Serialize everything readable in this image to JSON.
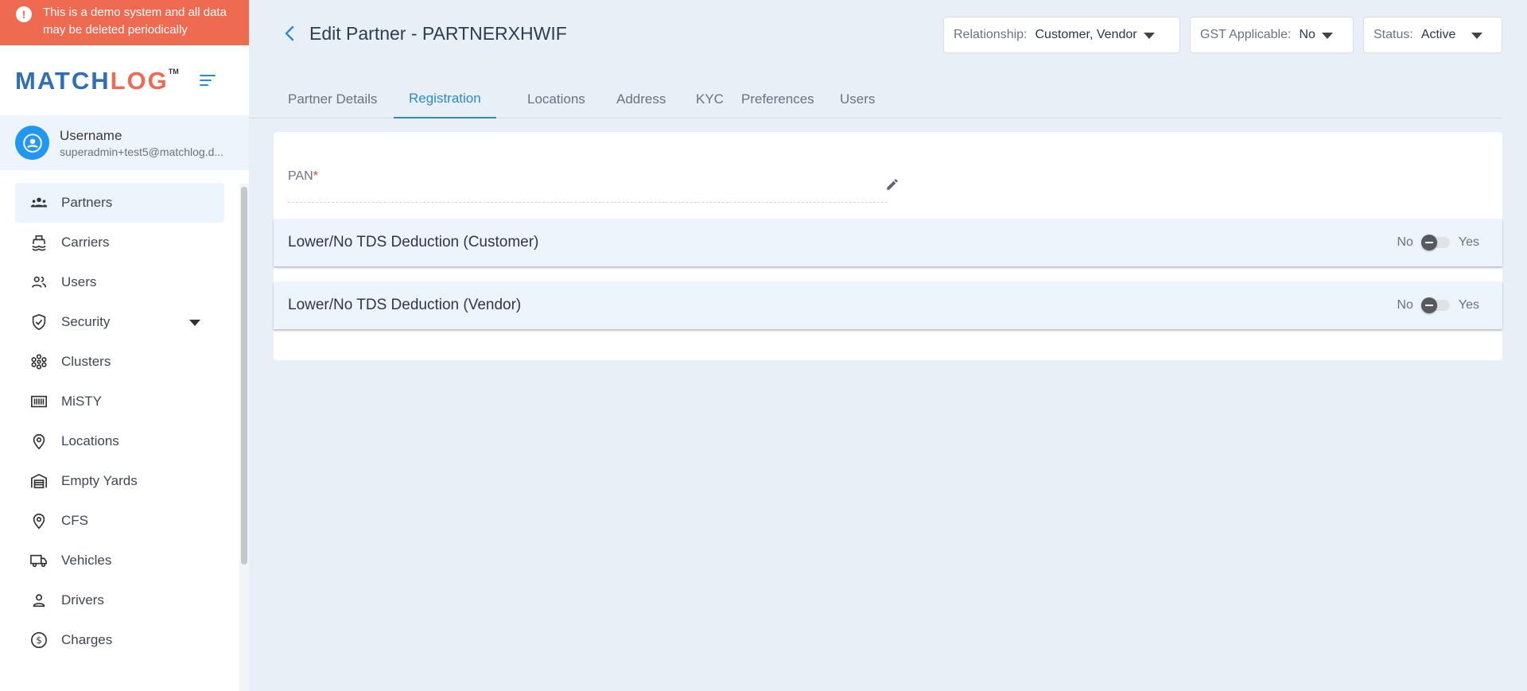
{
  "banner": {
    "text": "This is a demo system and all data may be deleted periodically"
  },
  "logo": {
    "part1": "MATCH",
    "part2": "LOG",
    "tm": "TM"
  },
  "user": {
    "name": "Username",
    "email": "superadmin+test5@matchlog.d..."
  },
  "nav": {
    "items": [
      {
        "label": "Partners",
        "icon": "partners-icon"
      },
      {
        "label": "Carriers",
        "icon": "ship-icon"
      },
      {
        "label": "Users",
        "icon": "users-icon"
      },
      {
        "label": "Security",
        "icon": "shield-icon"
      },
      {
        "label": "Clusters",
        "icon": "clusters-icon"
      },
      {
        "label": "MiSTY",
        "icon": "container-icon"
      },
      {
        "label": "Locations",
        "icon": "location-pin-icon"
      },
      {
        "label": "Empty Yards",
        "icon": "warehouse-icon"
      },
      {
        "label": "CFS",
        "icon": "location-pin-icon"
      },
      {
        "label": "Vehicles",
        "icon": "truck-icon"
      },
      {
        "label": "Drivers",
        "icon": "person-icon"
      },
      {
        "label": "Charges",
        "icon": "dollar-icon"
      }
    ]
  },
  "header": {
    "title": "Edit Partner - PARTNERXHWIF",
    "relationship": {
      "label": "Relationship:",
      "value": "Customer, Vendor"
    },
    "gst": {
      "label": "GST Applicable:",
      "value": "No"
    },
    "status": {
      "label": "Status:",
      "value": "Active"
    }
  },
  "tabs": [
    "Partner Details",
    "Registration",
    "Locations",
    "Address",
    "KYC",
    "Preferences",
    "Users"
  ],
  "form": {
    "pan_label": "PAN",
    "pan_required": "*",
    "panels": [
      {
        "title": "Lower/No TDS Deduction (Customer)",
        "no": "No",
        "yes": "Yes",
        "value": "No"
      },
      {
        "title": "Lower/No TDS Deduction (Vendor)",
        "no": "No",
        "yes": "Yes",
        "value": "No"
      }
    ]
  },
  "colors": {
    "accent": "#2a89d8",
    "banner": "#ee6a50",
    "brand_blue": "#2f6fb6"
  }
}
